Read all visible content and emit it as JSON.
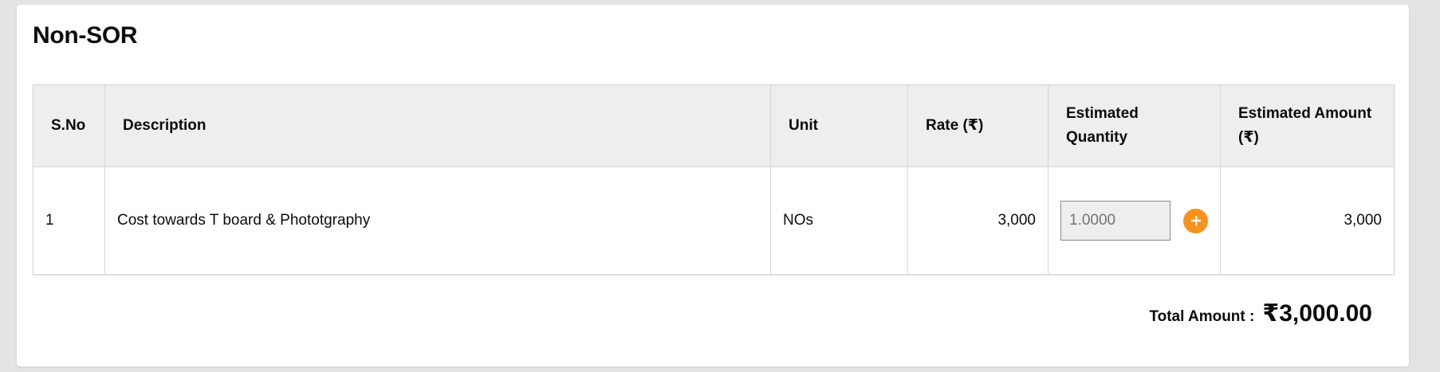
{
  "section": {
    "title": "Non-SOR"
  },
  "table": {
    "headers": {
      "sno": "S.No",
      "description": "Description",
      "unit": "Unit",
      "rate": "Rate (₹)",
      "estimated_quantity": "Estimated Quantity",
      "estimated_amount": "Estimated Amount (₹)"
    },
    "rows": [
      {
        "sno": "1",
        "description": "Cost towards T board & Phototgraphy",
        "unit": "NOs",
        "rate": "3,000",
        "estimated_quantity_placeholder": "1.0000",
        "estimated_amount": "3,000"
      }
    ]
  },
  "total": {
    "label": "Total Amount :",
    "value": "₹3,000.00"
  },
  "colors": {
    "header_bg": "#eeeeee",
    "border": "#d6d5d4",
    "add_button": "#f7931e",
    "input_bg": "#eeeeee"
  },
  "icons": {
    "add_button": "plus-icon"
  }
}
